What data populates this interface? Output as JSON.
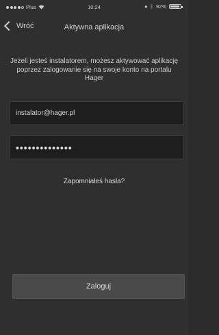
{
  "status_bar": {
    "carrier": "Plus",
    "time": "10:24",
    "battery_text": "92%",
    "battery_level": 0.92
  },
  "nav": {
    "back_label": "Wróć",
    "title": "Aktywna aplikacja"
  },
  "intro_text": "Jeżeli jesteś instalatorem, możesz aktywować aplikację poprzez zalogowanie się na swoje konto na portalu Hager",
  "form": {
    "email_value": "instalator@hager.pl",
    "password_value": "••••••••••••••"
  },
  "forgot_password_label": "Zapomniałeś hasła?",
  "login_button_label": "Zaloguj"
}
